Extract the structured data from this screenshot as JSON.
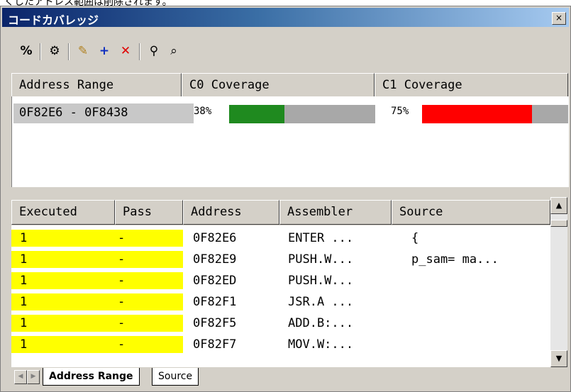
{
  "caption": "くしたアドレス範囲は削除されます。",
  "window": {
    "title": "コードカバレッジ",
    "close_label": "×"
  },
  "toolbar": {
    "items": [
      {
        "icon": "percent-icon",
        "glyph": "%"
      },
      {
        "icon": "coverage-icon",
        "glyph": "⚙"
      },
      {
        "icon": "edit-range-icon",
        "glyph": "✎"
      },
      {
        "icon": "add-range-icon",
        "glyph": "+"
      },
      {
        "icon": "delete-range-icon",
        "glyph": "✕"
      },
      {
        "icon": "find-icon",
        "glyph": "⚲"
      },
      {
        "icon": "binoculars-icon",
        "glyph": "⌕"
      }
    ]
  },
  "range_table": {
    "headers": [
      "Address Range",
      "C0 Coverage",
      "C1 Coverage"
    ],
    "rows": [
      {
        "range": "0F82E6 - 0F8438",
        "c0_pct": "38%",
        "c0": 0.38,
        "c1_pct": "75%",
        "c1": 0.75
      }
    ]
  },
  "detail_table": {
    "headers": [
      "Executed",
      "Pass",
      "Address",
      "Assembler",
      "Source"
    ],
    "rows": [
      {
        "executed": "1",
        "pass": "-",
        "address": "0F82E6",
        "assembler": "ENTER ...",
        "source": "{"
      },
      {
        "executed": "1",
        "pass": "-",
        "address": "0F82E9",
        "assembler": "PUSH.W...",
        "source": "p_sam= ma..."
      },
      {
        "executed": "1",
        "pass": "-",
        "address": "0F82ED",
        "assembler": "PUSH.W...",
        "source": ""
      },
      {
        "executed": "1",
        "pass": "-",
        "address": "0F82F1",
        "assembler": "JSR.A ...",
        "source": ""
      },
      {
        "executed": "1",
        "pass": "-",
        "address": "0F82F5",
        "assembler": "ADD.B:...",
        "source": ""
      },
      {
        "executed": "1",
        "pass": "-",
        "address": "0F82F7",
        "assembler": "MOV.W:...",
        "source": ""
      }
    ]
  },
  "tabs": [
    "Address Range",
    "Source"
  ],
  "colors": {
    "c0_fill": "#1f8a1f",
    "c1_fill": "#ff0000",
    "executed_bg": "#ffff00"
  }
}
